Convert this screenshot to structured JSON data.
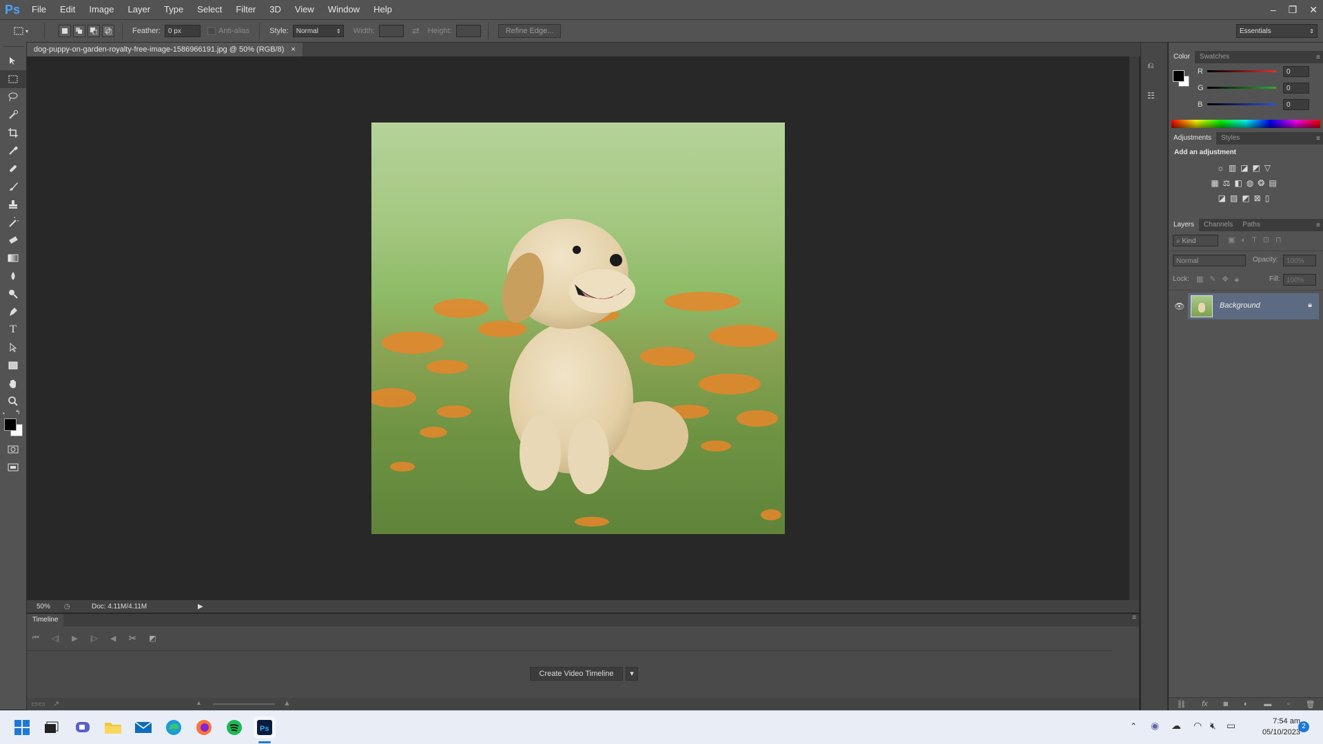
{
  "app": {
    "logo": "Ps",
    "menus": [
      "File",
      "Edit",
      "Image",
      "Layer",
      "Type",
      "Select",
      "Filter",
      "3D",
      "View",
      "Window",
      "Help"
    ]
  },
  "window_controls": {
    "minimize": "–",
    "restore": "❐",
    "close": "✕"
  },
  "options": {
    "feather_label": "Feather:",
    "feather_value": "0 px",
    "antialias_label": "Anti-alias",
    "style_label": "Style:",
    "style_value": "Normal",
    "width_label": "Width:",
    "height_label": "Height:",
    "refine_edge": "Refine Edge...",
    "workspace": "Essentials"
  },
  "document": {
    "tab_title": "dog-puppy-on-garden-royalty-free-image-1586966191.jpg @ 50% (RGB/8)",
    "tab_close": "×",
    "zoom": "50%",
    "doc_size": "Doc: 4.11M/4.11M"
  },
  "timeline": {
    "title": "Timeline",
    "create_button": "Create Video Timeline"
  },
  "color_panel": {
    "tabs": [
      "Color",
      "Swatches"
    ],
    "channels": [
      {
        "label": "R",
        "value": "0",
        "color": "#e03030"
      },
      {
        "label": "G",
        "value": "0",
        "color": "#30b030"
      },
      {
        "label": "B",
        "value": "0",
        "color": "#3050e0"
      }
    ]
  },
  "adjustments_panel": {
    "tabs": [
      "Adjustments",
      "Styles"
    ],
    "heading": "Add an adjustment"
  },
  "layers_panel": {
    "tabs": [
      "Layers",
      "Channels",
      "Paths"
    ],
    "kind_filter": "Kind",
    "blend_mode": "Normal",
    "opacity_label": "Opacity:",
    "opacity_value": "100%",
    "lock_label": "Lock:",
    "fill_label": "Fill:",
    "fill_value": "100%",
    "layers": [
      {
        "name": "Background"
      }
    ]
  },
  "taskbar": {
    "time": "7:54 am",
    "date": "05/10/2023",
    "notification_count": "2"
  }
}
